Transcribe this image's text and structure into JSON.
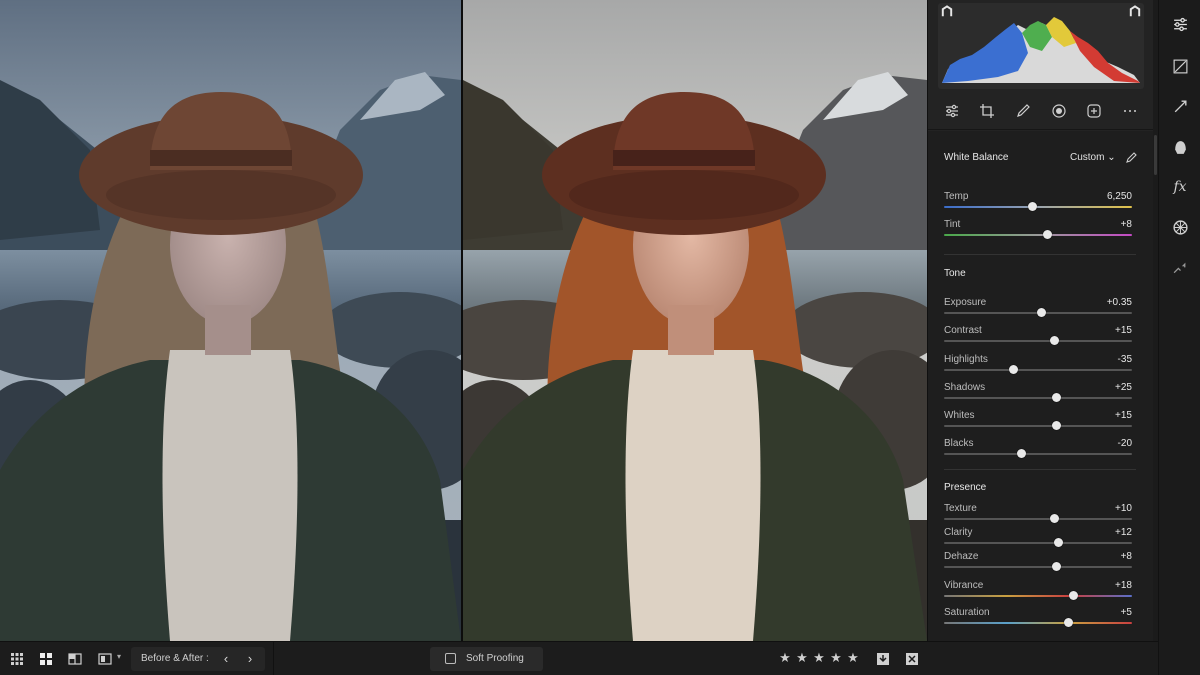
{
  "histogram": {
    "clip_shadow_icon": "triangle-clip-icon",
    "clip_highlight_icon": "triangle-clip-icon"
  },
  "tools": [
    "adjust-sliders-icon",
    "crop-icon",
    "brush-icon",
    "radial-mask-icon",
    "masking-icon",
    "more-icon"
  ],
  "white_balance": {
    "title": "White Balance",
    "mode": "Custom",
    "mode_arrow": "⌄"
  },
  "sliders": {
    "temp": {
      "label": "Temp",
      "value": "6,250",
      "position": 0.47
    },
    "tint": {
      "label": "Tint",
      "value": "+8",
      "position": 0.55
    },
    "exposure": {
      "label": "Exposure",
      "value": "+0.35",
      "position": 0.52
    },
    "contrast": {
      "label": "Contrast",
      "value": "+15",
      "position": 0.59
    },
    "highlights": {
      "label": "Highlights",
      "value": "-35",
      "position": 0.37
    },
    "shadows": {
      "label": "Shadows",
      "value": "+25",
      "position": 0.6
    },
    "whites": {
      "label": "Whites",
      "value": "+15",
      "position": 0.6
    },
    "blacks": {
      "label": "Blacks",
      "value": "-20",
      "position": 0.41
    },
    "texture": {
      "label": "Texture",
      "value": "+10",
      "position": 0.59
    },
    "clarity": {
      "label": "Clarity",
      "value": "+12",
      "position": 0.61
    },
    "dehaze": {
      "label": "Dehaze",
      "value": "+8",
      "position": 0.6
    },
    "vibrance": {
      "label": "Vibrance",
      "value": "+18",
      "position": 0.69
    },
    "saturation": {
      "label": "Saturation",
      "value": "+5",
      "position": 0.66
    }
  },
  "sections": {
    "tone": "Tone",
    "presence": "Presence"
  },
  "rail": [
    "edit-sliders-icon",
    "curve-icon",
    "detail-icon",
    "optics-icon",
    "effects-icon",
    "calibration-icon",
    "presets-icon"
  ],
  "rail_fx_label": "fx",
  "bottom": {
    "view_icons": [
      "grid-view-icon",
      "loupe-grid-icon",
      "compare-icon",
      "survey-icon"
    ],
    "before_after_label": "Before & After :",
    "prev_arrow": "‹",
    "next_arrow": "›",
    "soft_proofing_label": "Soft Proofing",
    "rating_stars": 5,
    "star_glyph": "★",
    "right_icons": [
      "import-icon",
      "grid-options-icon"
    ]
  }
}
